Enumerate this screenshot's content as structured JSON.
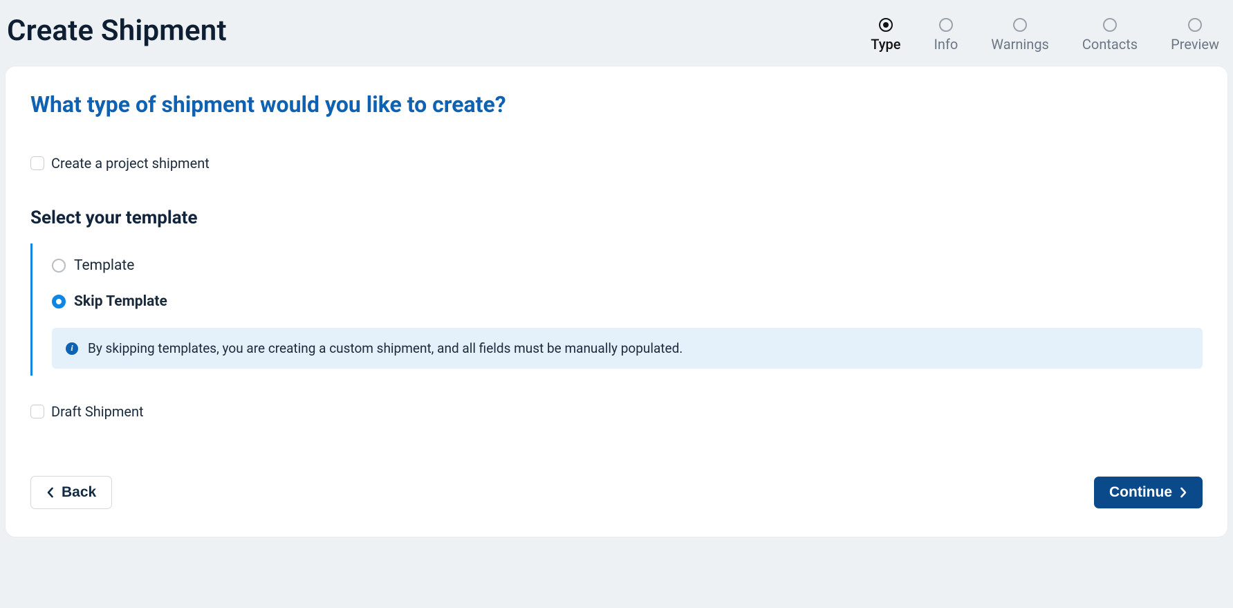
{
  "header": {
    "title": "Create Shipment"
  },
  "steps": [
    {
      "label": "Type",
      "active": true
    },
    {
      "label": "Info",
      "active": false
    },
    {
      "label": "Warnings",
      "active": false
    },
    {
      "label": "Contacts",
      "active": false
    },
    {
      "label": "Preview",
      "active": false
    }
  ],
  "main": {
    "question": "What type of shipment would you like to create?",
    "project_shipment_label": "Create a project shipment",
    "template_heading": "Select your template",
    "template_options": {
      "template_label": "Template",
      "skip_label": "Skip Template"
    },
    "info_banner": "By skipping templates, you are creating a custom shipment, and all fields must be manually populated.",
    "draft_label": "Draft Shipment"
  },
  "buttons": {
    "back": "Back",
    "continue": "Continue"
  }
}
